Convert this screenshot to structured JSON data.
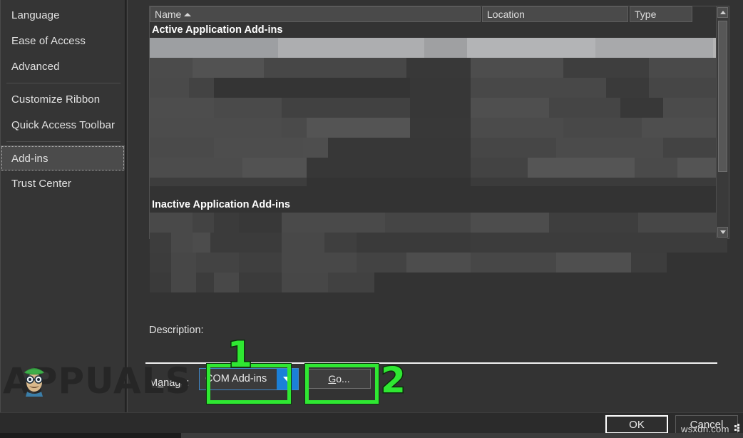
{
  "sidebar": {
    "items": [
      {
        "label": "Language",
        "selected": false,
        "divider_after": false
      },
      {
        "label": "Ease of Access",
        "selected": false,
        "divider_after": false
      },
      {
        "label": "Advanced",
        "selected": false,
        "divider_after": true
      },
      {
        "label": "Customize Ribbon",
        "selected": false,
        "divider_after": false
      },
      {
        "label": "Quick Access Toolbar",
        "selected": false,
        "divider_after": true
      },
      {
        "label": "Add-ins",
        "selected": true,
        "divider_after": false
      },
      {
        "label": "Trust Center",
        "selected": false,
        "divider_after": false
      }
    ]
  },
  "addins_list": {
    "columns": [
      {
        "label": "Name",
        "sorted": true,
        "sort_direction": "ascending"
      },
      {
        "label": "Location",
        "sorted": false,
        "sort_direction": ""
      },
      {
        "label": "Type",
        "sorted": false,
        "sort_direction": ""
      }
    ],
    "groups": [
      {
        "heading": "Active Application Add-ins",
        "row_count": 7,
        "first_row_selected": true
      },
      {
        "heading": "Inactive Application Add-ins",
        "row_count": 4,
        "first_row_selected": false
      }
    ],
    "content_redacted": true,
    "scrollbar": {
      "up_arrow_icon": "triangle-up-icon",
      "down_arrow_icon": "triangle-down-icon",
      "thumb_visible": true
    }
  },
  "description": {
    "label": "Description:",
    "value": ""
  },
  "manage": {
    "label": "Manage:",
    "label_accel": "a",
    "selected_option": "COM Add-ins",
    "dropdown_icon": "chevron-down-icon",
    "go_label": "Go...",
    "go_accel": "G"
  },
  "annotations": [
    {
      "number": "1",
      "target": "manage-combobox",
      "color": "#2fe832"
    },
    {
      "number": "2",
      "target": "go-button",
      "color": "#2fe832"
    }
  ],
  "dialog_buttons": {
    "ok_label": "OK",
    "ok_focused": true,
    "cancel_label": "Cancel"
  },
  "watermarks": {
    "brand": "APPUALS",
    "site": "wsxdn.com"
  },
  "colors": {
    "accent_blue": "#1b80d8",
    "annotation_green": "#2fe832",
    "panel_bg": "#333333",
    "sidebar_bg": "#353535",
    "selected_row": "#b4b4b4"
  }
}
